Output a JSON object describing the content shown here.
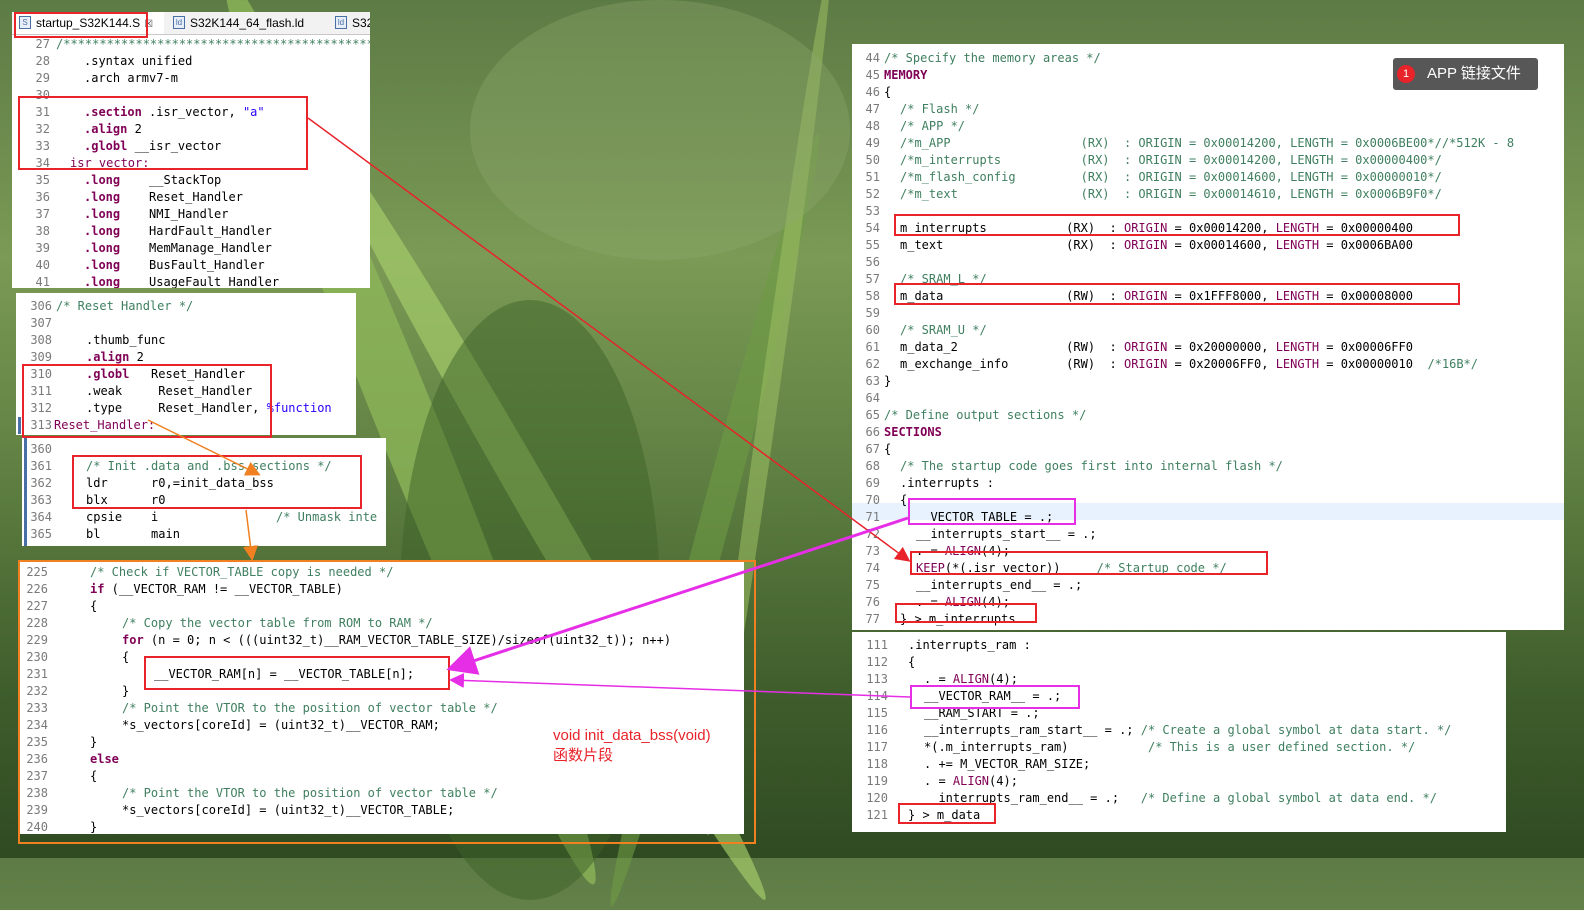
{
  "tabs": [
    {
      "label": "startup_S32K144.S",
      "close": "☒"
    },
    {
      "label": "S32K144_64_flash.ld"
    },
    {
      "label": "S32"
    }
  ],
  "startup_top": [
    {
      "n": "27",
      "text": "/*********************************************"
    },
    {
      "n": "28",
      "text": ".syntax unified"
    },
    {
      "n": "29",
      "text": ".arch armv7-m"
    },
    {
      "n": "30",
      "text": ""
    },
    {
      "n": "31",
      "kw": ".section",
      "rest": " .isr_vector, ",
      "str": "\"a\""
    },
    {
      "n": "32",
      "kw": ".align",
      "rest": " 2"
    },
    {
      "n": "33",
      "kw": ".globl",
      "rest": " __isr_vector"
    },
    {
      "n": "34",
      "label": "isr_vector:"
    },
    {
      "n": "35",
      "kw": ".long",
      "rest": "    __StackTop"
    },
    {
      "n": "36",
      "kw": ".long",
      "rest": "    Reset_Handler"
    },
    {
      "n": "37",
      "kw": ".long",
      "rest": "    NMI_Handler"
    },
    {
      "n": "38",
      "kw": ".long",
      "rest": "    HardFault_Handler"
    },
    {
      "n": "39",
      "kw": ".long",
      "rest": "    MemManage_Handler"
    },
    {
      "n": "40",
      "kw": ".long",
      "rest": "    BusFault_Handler"
    },
    {
      "n": "41",
      "kw": ".long",
      "rest": "    UsageFault_Handler"
    }
  ],
  "startup_reset": [
    {
      "n": "306",
      "comment": "/* Reset Handler */"
    },
    {
      "n": "307",
      "text": ""
    },
    {
      "n": "308",
      "text": ".thumb_func"
    },
    {
      "n": "309",
      "kw": ".align",
      "rest": " 2"
    },
    {
      "n": "310",
      "kw": ".globl",
      "rest": "   Reset_Handler"
    },
    {
      "n": "311",
      "text": ".weak     Reset_Handler"
    },
    {
      "n": "312",
      "text": ".type     Reset_Handler, ",
      "str": "%function"
    },
    {
      "n": "313",
      "label": "Reset_Handler:"
    }
  ],
  "startup_init": [
    {
      "n": "360",
      "text": ""
    },
    {
      "n": "361",
      "comment": "/* Init .data and .bss sections */"
    },
    {
      "n": "362",
      "text": "ldr      r0,=init_data_bss"
    },
    {
      "n": "363",
      "text": "blx      r0"
    },
    {
      "n": "364",
      "text": "cpsie    i",
      "comment2": "/* Unmask inte"
    },
    {
      "n": "365",
      "text": "bl       main"
    }
  ],
  "c_code": [
    {
      "n": "225",
      "indent": 1,
      "comment": "/* Check if VECTOR_TABLE copy is needed */"
    },
    {
      "n": "226",
      "indent": 1,
      "kw": "if",
      "rest": " (__VECTOR_RAM != __VECTOR_TABLE)"
    },
    {
      "n": "227",
      "indent": 1,
      "text": "{"
    },
    {
      "n": "228",
      "indent": 2,
      "comment": "/* Copy the vector table from ROM to RAM */"
    },
    {
      "n": "229",
      "indent": 2,
      "kw": "for",
      "rest": " (n = 0; n < (((uint32_t)__RAM_VECTOR_TABLE_SIZE)/sizeof(uint32_t)); n++)"
    },
    {
      "n": "230",
      "indent": 2,
      "text": "{"
    },
    {
      "n": "231",
      "indent": 3,
      "text": "__VECTOR_RAM[n] = __VECTOR_TABLE[n];"
    },
    {
      "n": "232",
      "indent": 2,
      "text": "}"
    },
    {
      "n": "233",
      "indent": 2,
      "comment": "/* Point the VTOR to the position of vector table */"
    },
    {
      "n": "234",
      "indent": 2,
      "text": "*s_vectors[coreId] = (uint32_t)__VECTOR_RAM;"
    },
    {
      "n": "235",
      "indent": 1,
      "text": "}"
    },
    {
      "n": "236",
      "indent": 1,
      "kw": "else",
      "rest": ""
    },
    {
      "n": "237",
      "indent": 1,
      "text": "{"
    },
    {
      "n": "238",
      "indent": 2,
      "comment": "/* Point the VTOR to the position of vector table */"
    },
    {
      "n": "239",
      "indent": 2,
      "text": "*s_vectors[coreId] = (uint32_t)__VECTOR_TABLE;"
    },
    {
      "n": "240",
      "indent": 1,
      "text": "}"
    }
  ],
  "caption": {
    "line1": "void init_data_bss(void)",
    "line2": "函数片段"
  },
  "badge": {
    "num": "1",
    "text": "APP 链接文件"
  },
  "ld_top": [
    {
      "n": "44",
      "comment": "/* Specify the memory areas */"
    },
    {
      "n": "45",
      "kw": "MEMORY"
    },
    {
      "n": "46",
      "text": "{"
    },
    {
      "n": "47",
      "indent": 1,
      "comment": "/* Flash */"
    },
    {
      "n": "48",
      "indent": 1,
      "comment": "/* APP */"
    },
    {
      "n": "49",
      "indent": 1,
      "comment": "/*m_APP                  (RX)  : ORIGIN = 0x00014200, LENGTH = 0x0006BE00*//*512K - 8"
    },
    {
      "n": "50",
      "indent": 1,
      "comment": "/*m_interrupts           (RX)  : ORIGIN = 0x00014200, LENGTH = 0x00000400*/"
    },
    {
      "n": "51",
      "indent": 1,
      "comment": "/*m_flash_config         (RX)  : ORIGIN = 0x00014600, LENGTH = 0x00000010*/"
    },
    {
      "n": "52",
      "indent": 1,
      "comment": "/*m_text                 (RX)  : ORIGIN = 0x00014610, LENGTH = 0x0006B9F0*/"
    },
    {
      "n": "53",
      "text": ""
    },
    {
      "n": "54",
      "indent": 1,
      "mem": [
        "m_interrupts           (RX)  : ",
        "ORIGIN",
        " = 0x00014200, ",
        "LENGTH",
        " = 0x00000400"
      ]
    },
    {
      "n": "55",
      "indent": 1,
      "mem": [
        "m_text                 (RX)  : ",
        "ORIGIN",
        " = 0x00014600, ",
        "LENGTH",
        " = 0x0006BA00"
      ]
    },
    {
      "n": "56",
      "text": ""
    },
    {
      "n": "57",
      "indent": 1,
      "comment": "/* SRAM_L */"
    },
    {
      "n": "58",
      "indent": 1,
      "mem": [
        "m_data                 (RW)  : ",
        "ORIGIN",
        " = 0x1FFF8000, ",
        "LENGTH",
        " = 0x00008000"
      ]
    },
    {
      "n": "59",
      "text": ""
    },
    {
      "n": "60",
      "indent": 1,
      "comment": "/* SRAM_U */"
    },
    {
      "n": "61",
      "indent": 1,
      "mem": [
        "m_data_2               (RW)  : ",
        "ORIGIN",
        " = 0x20000000, ",
        "LENGTH",
        " = 0x00006FF0"
      ]
    },
    {
      "n": "62",
      "indent": 1,
      "mem": [
        "m_exchange_info        (RW)  : ",
        "ORIGIN",
        " = 0x20006FF0, ",
        "LENGTH",
        " = 0x00000010  "
      ],
      "tail": "/*16B*/"
    },
    {
      "n": "63",
      "text": "}"
    },
    {
      "n": "64",
      "text": ""
    },
    {
      "n": "65",
      "comment": "/* Define output sections */"
    },
    {
      "n": "66",
      "kw": "SECTIONS"
    },
    {
      "n": "67",
      "text": "{"
    },
    {
      "n": "68",
      "indent": 1,
      "comment": "/* The startup code goes first into internal flash */"
    },
    {
      "n": "69",
      "indent": 1,
      "text": ".interrupts :"
    },
    {
      "n": "70",
      "indent": 1,
      "text": "{"
    },
    {
      "n": "71",
      "indent": 2,
      "text": "__VECTOR_TABLE = .;"
    },
    {
      "n": "72",
      "indent": 2,
      "text": "__interrupts_start__ = .;"
    },
    {
      "n": "73",
      "indent": 2,
      "pre": ". = ",
      "fn": "ALIGN",
      "post": "(4);"
    },
    {
      "n": "74",
      "indent": 2,
      "fn0": "KEEP",
      "post0": "(*(.isr_vector))     ",
      "comment": "/* Startup code */"
    },
    {
      "n": "75",
      "indent": 2,
      "text": "__interrupts_end__ = .;"
    },
    {
      "n": "76",
      "indent": 2,
      "pre": ". = ",
      "fn": "ALIGN",
      "post": "(4);"
    },
    {
      "n": "77",
      "indent": 1,
      "text": "} > m_interrupts"
    }
  ],
  "ld_bottom": [
    {
      "n": "111",
      "indent": 1,
      "text": ".interrupts_ram :"
    },
    {
      "n": "112",
      "indent": 1,
      "text": "{"
    },
    {
      "n": "113",
      "indent": 2,
      "pre": ". = ",
      "fn": "ALIGN",
      "post": "(4);"
    },
    {
      "n": "114",
      "indent": 2,
      "text": "__VECTOR_RAM__ = .;"
    },
    {
      "n": "115",
      "indent": 2,
      "text": "__RAM_START = .;"
    },
    {
      "n": "116",
      "indent": 2,
      "text": "__interrupts_ram_start__ = .; ",
      "comment": "/* Create a global symbol at data start. */"
    },
    {
      "n": "117",
      "indent": 2,
      "text": "*(.m_interrupts_ram)           ",
      "comment": "/* This is a user defined section. */"
    },
    {
      "n": "118",
      "indent": 2,
      "text": ". += M_VECTOR_RAM_SIZE;"
    },
    {
      "n": "119",
      "indent": 2,
      "pre": ". = ",
      "fn": "ALIGN",
      "post": "(4);"
    },
    {
      "n": "120",
      "indent": 2,
      "text": "__interrupts_ram_end__ = .;   ",
      "comment": "/* Define a global symbol at data end. */"
    },
    {
      "n": "121",
      "indent": 1,
      "text": "} > m_data"
    }
  ],
  "colors": {
    "red": "#e8232a",
    "magenta": "#e62ee6",
    "orange": "#f08020"
  }
}
